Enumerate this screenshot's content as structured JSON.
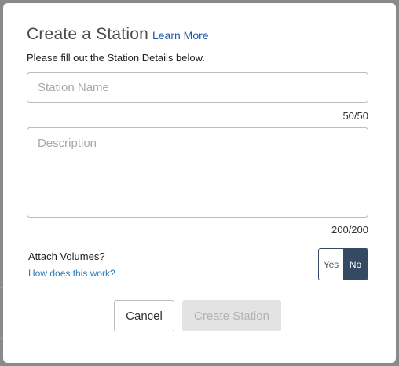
{
  "modal": {
    "title": "Create a Station",
    "learn_more_label": "Learn More",
    "subtitle": "Please fill out the Station Details below."
  },
  "form": {
    "station_name": {
      "placeholder": "Station Name",
      "value": "",
      "counter": "50/50"
    },
    "description": {
      "placeholder": "Description",
      "value": "",
      "counter": "200/200"
    },
    "attach_volumes": {
      "label": "Attach Volumes?",
      "help_link": "How does this work?",
      "options": [
        "Yes",
        "No"
      ],
      "selected": "No"
    }
  },
  "actions": {
    "cancel_label": "Cancel",
    "create_label": "Create Station",
    "create_disabled": true
  },
  "colors": {
    "link": "#1f57a8",
    "help_link": "#2b7bb8",
    "toggle_selected": "#344a63",
    "disabled_button": "#e3e3e3",
    "overlay": "#8a8a8a"
  }
}
